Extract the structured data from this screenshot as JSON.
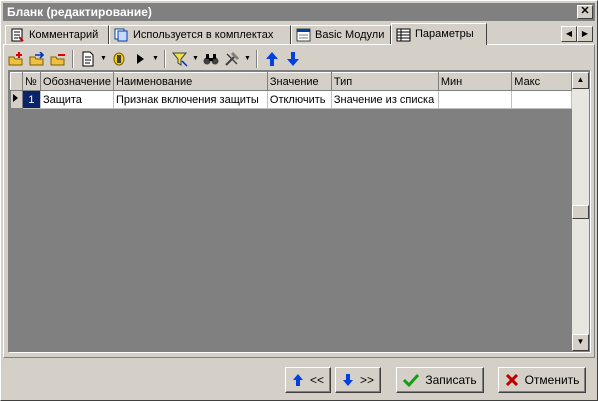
{
  "window": {
    "title": "Бланк (редактирование)",
    "close_label": "✕"
  },
  "tabs": [
    {
      "label": "Комментарий",
      "icon": "comment-icon",
      "active": false
    },
    {
      "label": "Используется в комплектах",
      "icon": "kits-icon",
      "active": false
    },
    {
      "label": "Basic Модули",
      "icon": "basic-modules-icon",
      "active": false
    },
    {
      "label": "Параметры",
      "icon": "parameters-icon",
      "active": true
    }
  ],
  "toolbar": {
    "icons": [
      "add-record-icon",
      "insert-record-icon",
      "delete-record-icon",
      "document-icon",
      "property-icon",
      "run-icon",
      "filter-icon",
      "find-icon",
      "tools-icon",
      "move-up-icon",
      "move-down-icon"
    ]
  },
  "grid": {
    "columns": [
      "№",
      "Обозначение",
      "Наименование",
      "Значение",
      "Тип",
      "Мин",
      "Макс"
    ],
    "rows": [
      {
        "num": "1",
        "code": "Защита",
        "name": "Признак включения защиты",
        "value": "Отключить",
        "type": "Значение из списка",
        "min": "",
        "max": ""
      }
    ]
  },
  "buttons": {
    "prev_label": "<<",
    "next_label": ">>",
    "save_label": "Записать",
    "cancel_label": "Отменить"
  },
  "colors": {
    "selection": "#0a246a",
    "save_check": "#1a9a1a",
    "cancel_x": "#c00000",
    "arrow": "#0040e0"
  }
}
